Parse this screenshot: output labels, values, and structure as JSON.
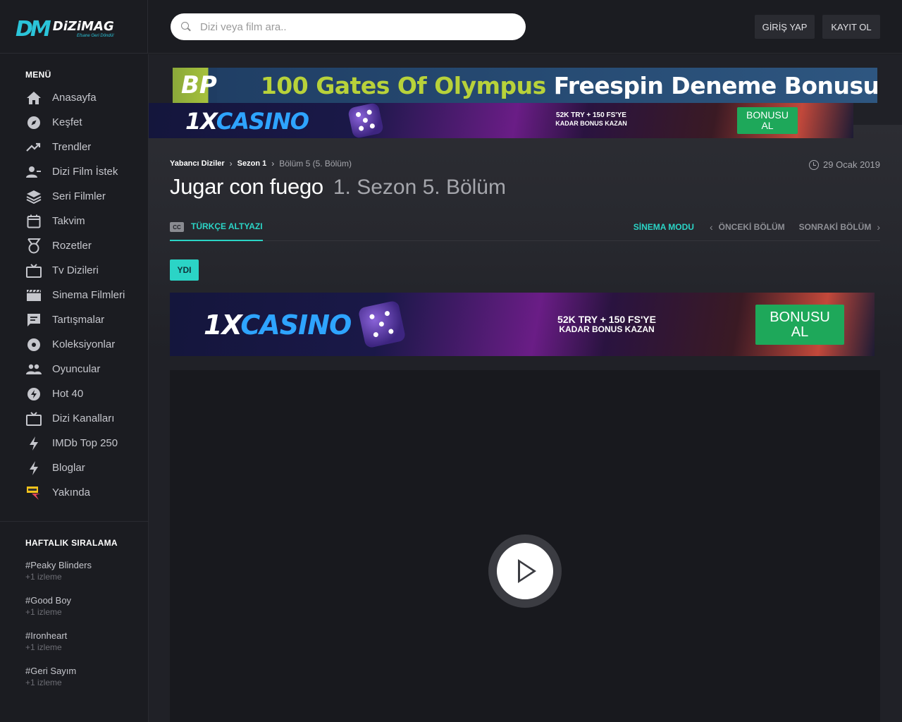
{
  "brand": {
    "name": "DiZiMAG",
    "mark": "DM",
    "tagline": "Efsane Geri Döndü!"
  },
  "search": {
    "placeholder": "Dizi veya film ara.."
  },
  "auth": {
    "login": "GİRİŞ YAP",
    "register": "KAYIT OL"
  },
  "sidebar": {
    "menu_title": "MENÜ",
    "items": [
      {
        "label": "Anasayfa",
        "icon": "home-icon"
      },
      {
        "label": "Keşfet",
        "icon": "compass-icon"
      },
      {
        "label": "Trendler",
        "icon": "trending-icon"
      },
      {
        "label": "Dizi Film İstek",
        "icon": "user-add-icon"
      },
      {
        "label": "Seri Filmler",
        "icon": "layers-icon"
      },
      {
        "label": "Takvim",
        "icon": "calendar-icon"
      },
      {
        "label": "Rozetler",
        "icon": "medal-icon"
      },
      {
        "label": "Tv Dizileri",
        "icon": "tv-icon"
      },
      {
        "label": "Sinema Filmleri",
        "icon": "film-icon"
      },
      {
        "label": "Tartışmalar",
        "icon": "chat-icon"
      },
      {
        "label": "Koleksiyonlar",
        "icon": "disc-icon"
      },
      {
        "label": "Oyuncular",
        "icon": "people-icon"
      },
      {
        "label": "Hot 40",
        "icon": "bolt-circle-icon"
      },
      {
        "label": "Dizi Kanalları",
        "icon": "tv-icon"
      },
      {
        "label": "IMDb Top 250",
        "icon": "bolt-icon"
      },
      {
        "label": "Bloglar",
        "icon": "bolt-icon"
      },
      {
        "label": "Yakında",
        "icon": "soon-icon"
      }
    ],
    "weekly_title": "HAFTALIK SIRALAMA",
    "weekly": [
      {
        "name": "#Peaky Blinders",
        "views": "+1 izleme"
      },
      {
        "name": "#Good Boy",
        "views": "+1 izleme"
      },
      {
        "name": "#Ironheart",
        "views": "+1 izleme"
      },
      {
        "name": "#Geri Sayım",
        "views": "+1 izleme"
      }
    ]
  },
  "ads": {
    "bp": {
      "logo": "BP",
      "green_text": "100 Gates Of Olympus",
      "white_text": "Freespin Deneme Bonusu!"
    },
    "casino": {
      "logo_a": "1X",
      "logo_b": "CASINO",
      "promo_line1": "52K TRY + 150 FS'YE",
      "promo_line2": "KADAR BONUS KAZAN",
      "button_line1": "BONUSU",
      "button_line2": "AL"
    }
  },
  "breadcrumb": {
    "level1": "Yabancı Diziler",
    "level2": "Sezon 1",
    "current": "Bölüm 5 (5. Bölüm)"
  },
  "date": "29 Ocak 2019",
  "title": {
    "show": "Jugar con fuego",
    "episode": "1. Sezon 5. Bölüm"
  },
  "tabs": {
    "subtitle": "TÜRKÇE ALTYAZI",
    "cc": "CC"
  },
  "nav": {
    "cinema": "SİNEMA MODU",
    "prev": "ÖNCEKİ BÖLÜM",
    "next": "SONRAKİ BÖLÜM"
  },
  "source_badge": "YDI",
  "colors": {
    "accent": "#2bd4c6",
    "background": "#1b1c21",
    "brand": "#2bc4d9",
    "ad_button": "#1ea85a"
  }
}
